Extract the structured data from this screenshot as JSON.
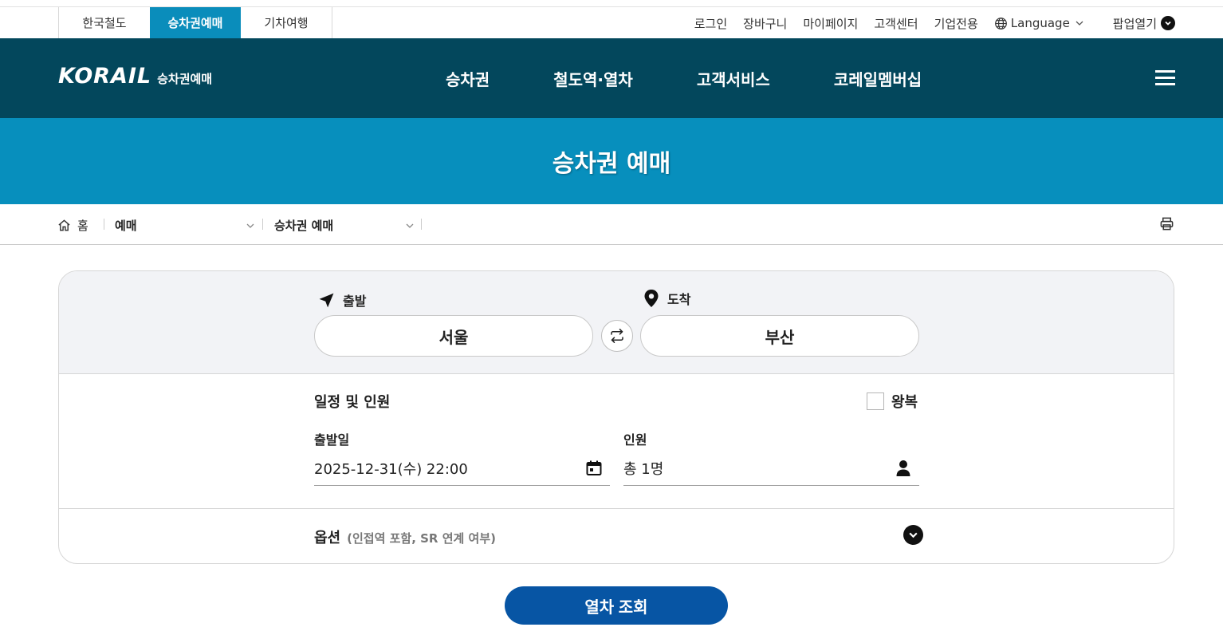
{
  "site_tabs": [
    "한국철도",
    "승차권예매",
    "기차여행"
  ],
  "util_links": {
    "login": "로그인",
    "cart": "장바구니",
    "mypage": "마이페이지",
    "support": "고객센터",
    "corporate": "기업전용",
    "language": "Language",
    "popup": "팝업열기"
  },
  "logo": {
    "word": "KORAIL",
    "sub": "승차권예매"
  },
  "main_menu": [
    "승차권",
    "철도역·열차",
    "고객서비스",
    "코레일멤버십"
  ],
  "page_title": "승차권 예매",
  "breadcrumb": {
    "home": "홈",
    "level1": "예매",
    "level2": "승차권 예매"
  },
  "search": {
    "departure_label": "출발",
    "arrival_label": "도착",
    "departure_station": "서울",
    "arrival_station": "부산",
    "schedule_title": "일정 및 인원",
    "roundtrip_label": "왕복",
    "date_label": "출발일",
    "date_value": "2025-12-31(수) 22:00",
    "passengers_label": "인원",
    "passengers_value": "총 1명",
    "options_label": "옵션",
    "options_sub": "(인접역 포함, SR 연계 여부)",
    "submit_label": "열차 조회"
  },
  "colors": {
    "nav_bg": "#03475c",
    "title_band": "#078fbd",
    "active_tab": "#0a8dbb",
    "search_button": "#0755a4"
  },
  "icons": [
    "globe-icon",
    "chevron-down-icon",
    "hamburger-icon",
    "home-icon",
    "print-icon",
    "location-arrow-icon",
    "map-pin-icon",
    "swap-icon",
    "calendar-icon",
    "person-icon"
  ]
}
